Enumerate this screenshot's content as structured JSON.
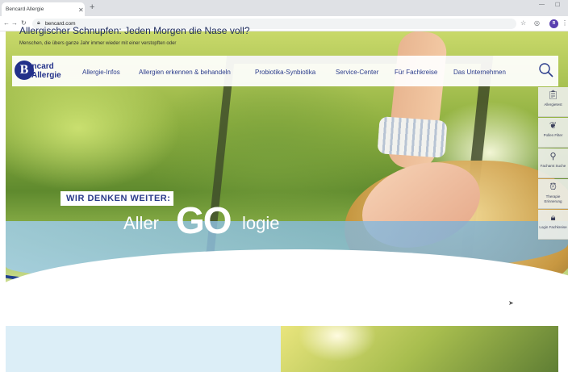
{
  "browser": {
    "tab_title": "Bencard Allergie",
    "tab_close": "✕",
    "new_tab": "+",
    "url": "bencard.com",
    "profile_initial": "R"
  },
  "site": {
    "logo_line1": "encard",
    "logo_line2": "Allergie",
    "logo_letter": "B",
    "nav": [
      "Allergie-Infos",
      "Allergien erkennen & behandeln",
      "Probiotika-Synbiotika",
      "Service-Center",
      "Für Fachkreise",
      "Das Unternehmen"
    ],
    "side_tools": [
      {
        "label": "Allergietest",
        "icon": "clipboard-icon"
      },
      {
        "label": "Pollen Filter",
        "icon": "leaf-icon"
      },
      {
        "label": "Fachamt Suche",
        "icon": "search-icon"
      },
      {
        "label": "Therapie Erinnerung",
        "icon": "alarm-icon"
      },
      {
        "label": "Login Fachkreise",
        "icon": "lock-icon"
      }
    ]
  },
  "hero": {
    "headline": "WIR DENKEN WEITER:",
    "brand_aller": "Aller",
    "brand_go": "GO",
    "brand_logie": "logie"
  },
  "teaser": {
    "title": "Allergischer Schnupfen: Jeden Morgen die Nase voll?",
    "text": "Menschen, die übers ganze Jahr immer wieder mit einer verstopften oder"
  },
  "colors": {
    "brand_blue": "#22318a",
    "nav_text": "#2b3c8c",
    "teaser_bg": "#dceef7"
  }
}
